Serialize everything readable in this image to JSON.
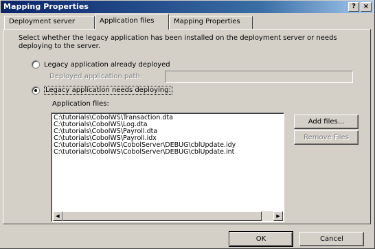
{
  "window": {
    "title": "Mapping Properties",
    "help_glyph": "?",
    "close_glyph": "×"
  },
  "tabs": [
    {
      "label": "Deployment server",
      "active": false
    },
    {
      "label": "Application files",
      "active": true
    },
    {
      "label": "Mapping Properties",
      "active": false
    }
  ],
  "panel": {
    "description": "Select whether the legacy application has been installed on the deployment server or needs deploying to the server.",
    "option_deployed_label": "Legacy application already deployed",
    "deployed_path_label": "Deployed application path:",
    "deployed_path_value": "",
    "option_needs_deploying_label": "Legacy application needs deploying:",
    "app_files_label": "Application files:",
    "selected_option": "needs_deploying",
    "files": [
      "C:\\tutorials\\CobolWS\\Transaction.dta",
      "C:\\tutorials\\CobolWS\\Log.dta",
      "C:\\tutorials\\CobolWS\\Payroll.dta",
      "C:\\tutorials\\CobolWS\\Payroll.idx",
      "C:\\tutorials\\CobolWS\\CobolServer\\DEBUG\\cblUpdate.idy",
      "C:\\tutorials\\CobolWS\\CobolServer\\DEBUG\\cblUpdate.int"
    ],
    "add_files_label": "Add files...",
    "remove_files_label": "Remove Files"
  },
  "footer": {
    "ok_label": "OK",
    "cancel_label": "Cancel"
  },
  "icons": {
    "scroll_left": "◀",
    "scroll_right": "▶"
  }
}
